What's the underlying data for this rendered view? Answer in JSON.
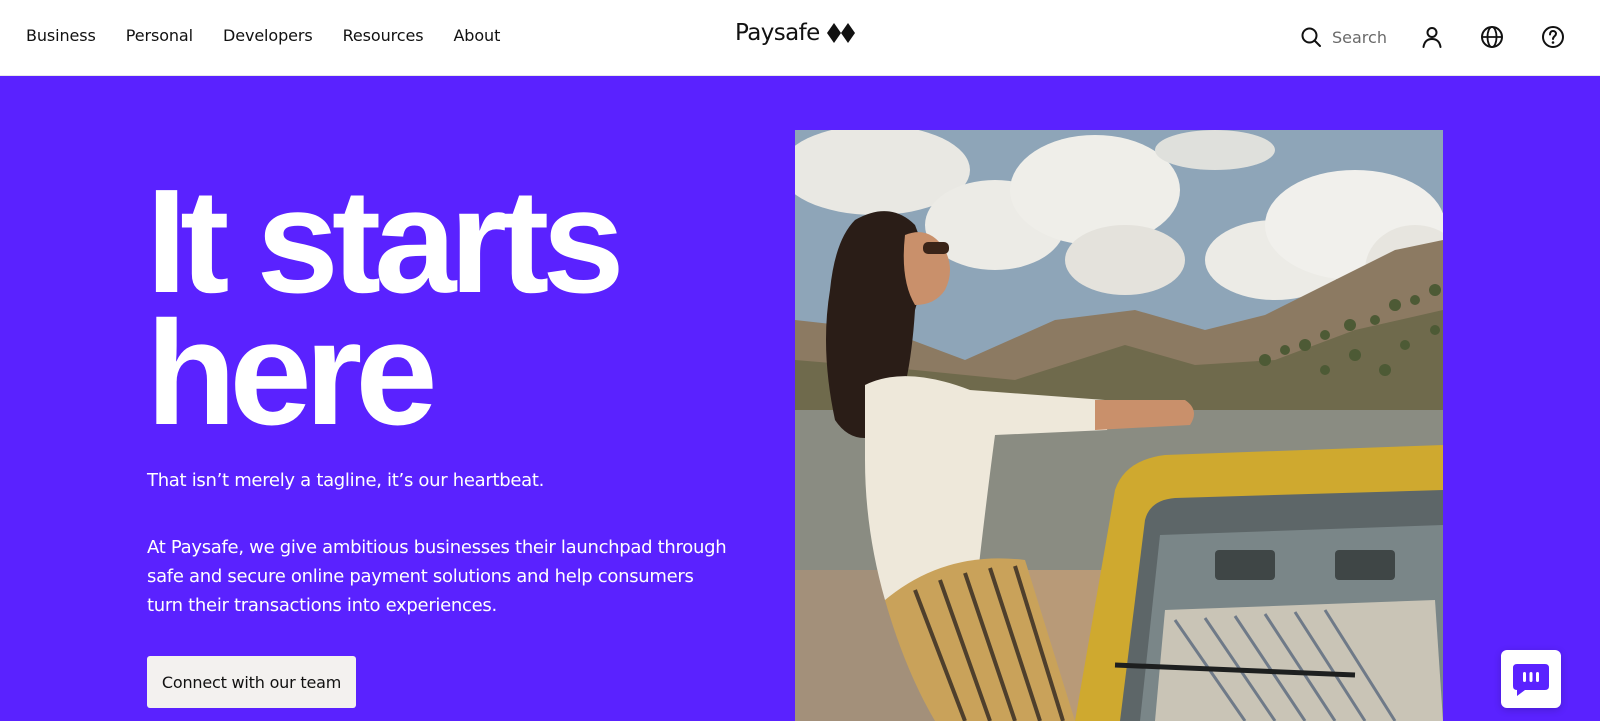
{
  "nav": {
    "items": [
      {
        "label": "Business"
      },
      {
        "label": "Personal"
      },
      {
        "label": "Developers"
      },
      {
        "label": "Resources"
      },
      {
        "label": "About"
      }
    ]
  },
  "logo": {
    "text": "Paysafe",
    "icon": "paysafe-diamonds-logo"
  },
  "utility": {
    "search_label": "Search",
    "search_icon": "search-icon",
    "account_icon": "user-icon",
    "language_icon": "globe-icon",
    "help_icon": "help-icon"
  },
  "hero": {
    "headline_line1": "It starts",
    "headline_line2": "here",
    "tagline": "That isn’t merely a tagline, it’s our heartbeat.",
    "body": "At Paysafe, we give ambitious businesses their launchpad through safe and secure online payment solutions and help consumers turn their transactions into experiences.",
    "cta_label": "Connect with our team"
  },
  "chat": {
    "icon": "chat-icon"
  },
  "colors": {
    "brand_purple": "#5a22ff",
    "header_bg": "#ffffff",
    "cta_bg": "#f3f1ef"
  }
}
